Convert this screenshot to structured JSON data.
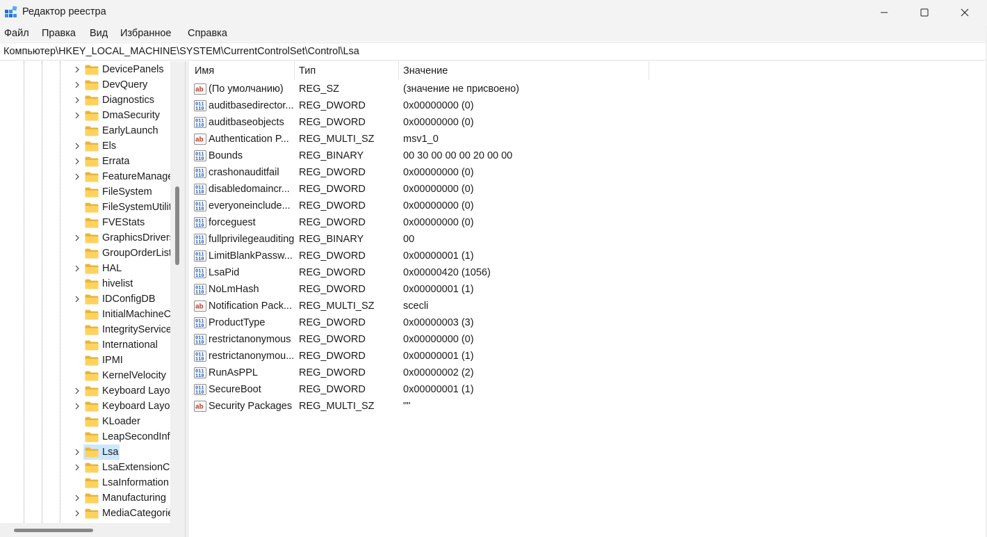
{
  "window": {
    "title": "Редактор реестра"
  },
  "menu": [
    "Файл",
    "Правка",
    "Вид",
    "Избранное",
    "Справка"
  ],
  "address": "Компьютер\\HKEY_LOCAL_MACHINE\\SYSTEM\\CurrentControlSet\\Control\\Lsa",
  "tree": [
    {
      "label": "DevicePanels",
      "expandable": true
    },
    {
      "label": "DevQuery",
      "expandable": true
    },
    {
      "label": "Diagnostics",
      "expandable": true
    },
    {
      "label": "DmaSecurity",
      "expandable": true
    },
    {
      "label": "EarlyLaunch",
      "expandable": false
    },
    {
      "label": "Els",
      "expandable": true
    },
    {
      "label": "Errata",
      "expandable": true
    },
    {
      "label": "FeatureManagement",
      "expandable": true
    },
    {
      "label": "FileSystem",
      "expandable": false
    },
    {
      "label": "FileSystemUtilities",
      "expandable": false
    },
    {
      "label": "FVEStats",
      "expandable": false
    },
    {
      "label": "GraphicsDrivers",
      "expandable": true
    },
    {
      "label": "GroupOrderList",
      "expandable": false
    },
    {
      "label": "HAL",
      "expandable": true
    },
    {
      "label": "hivelist",
      "expandable": false
    },
    {
      "label": "IDConfigDB",
      "expandable": true
    },
    {
      "label": "InitialMachineConfig",
      "expandable": false
    },
    {
      "label": "IntegrityServices",
      "expandable": false
    },
    {
      "label": "International",
      "expandable": false
    },
    {
      "label": "IPMI",
      "expandable": false
    },
    {
      "label": "KernelVelocity",
      "expandable": false
    },
    {
      "label": "Keyboard Layout",
      "expandable": true
    },
    {
      "label": "Keyboard Layouts",
      "expandable": true
    },
    {
      "label": "KLoader",
      "expandable": false
    },
    {
      "label": "LeapSecondInformation",
      "expandable": false
    },
    {
      "label": "Lsa",
      "expandable": true,
      "selected": true
    },
    {
      "label": "LsaExtensionConfig",
      "expandable": true
    },
    {
      "label": "LsaInformation",
      "expandable": false
    },
    {
      "label": "Manufacturing",
      "expandable": true
    },
    {
      "label": "MediaCategories",
      "expandable": true
    }
  ],
  "columns": {
    "name": "Имя",
    "type": "Тип",
    "data": "Значение"
  },
  "values": [
    {
      "icon": "string",
      "name": "(По умолчанию)",
      "type": "REG_SZ",
      "data": "(значение не присвоено)"
    },
    {
      "icon": "binary",
      "name": "auditbasedirectories",
      "type": "REG_DWORD",
      "data": "0x00000000 (0)"
    },
    {
      "icon": "binary",
      "name": "auditbaseobjects",
      "type": "REG_DWORD",
      "data": "0x00000000 (0)"
    },
    {
      "icon": "string",
      "name": "Authentication Packages",
      "type": "REG_MULTI_SZ",
      "data": "msv1_0"
    },
    {
      "icon": "binary",
      "name": "Bounds",
      "type": "REG_BINARY",
      "data": "00 30 00 00 00 20 00 00"
    },
    {
      "icon": "binary",
      "name": "crashonauditfail",
      "type": "REG_DWORD",
      "data": "0x00000000 (0)"
    },
    {
      "icon": "binary",
      "name": "disabledomaincreds",
      "type": "REG_DWORD",
      "data": "0x00000000 (0)"
    },
    {
      "icon": "binary",
      "name": "everyoneincludesanonymous",
      "type": "REG_DWORD",
      "data": "0x00000000 (0)"
    },
    {
      "icon": "binary",
      "name": "forceguest",
      "type": "REG_DWORD",
      "data": "0x00000000 (0)"
    },
    {
      "icon": "binary",
      "name": "fullprivilegeauditing",
      "type": "REG_BINARY",
      "data": "00"
    },
    {
      "icon": "binary",
      "name": "LimitBlankPasswordUse",
      "type": "REG_DWORD",
      "data": "0x00000001 (1)"
    },
    {
      "icon": "binary",
      "name": "LsaPid",
      "type": "REG_DWORD",
      "data": "0x00000420 (1056)"
    },
    {
      "icon": "binary",
      "name": "NoLmHash",
      "type": "REG_DWORD",
      "data": "0x00000001 (1)"
    },
    {
      "icon": "string",
      "name": "Notification Packages",
      "type": "REG_MULTI_SZ",
      "data": "scecli"
    },
    {
      "icon": "binary",
      "name": "ProductType",
      "type": "REG_DWORD",
      "data": "0x00000003 (3)"
    },
    {
      "icon": "binary",
      "name": "restrictanonymous",
      "type": "REG_DWORD",
      "data": "0x00000000 (0)"
    },
    {
      "icon": "binary",
      "name": "restrictanonymoussam",
      "type": "REG_DWORD",
      "data": "0x00000001 (1)"
    },
    {
      "icon": "binary",
      "name": "RunAsPPL",
      "type": "REG_DWORD",
      "data": "0x00000002 (2)"
    },
    {
      "icon": "binary",
      "name": "SecureBoot",
      "type": "REG_DWORD",
      "data": "0x00000001 (1)"
    },
    {
      "icon": "string",
      "name": "Security Packages",
      "type": "REG_MULTI_SZ",
      "data": "\"\""
    }
  ]
}
